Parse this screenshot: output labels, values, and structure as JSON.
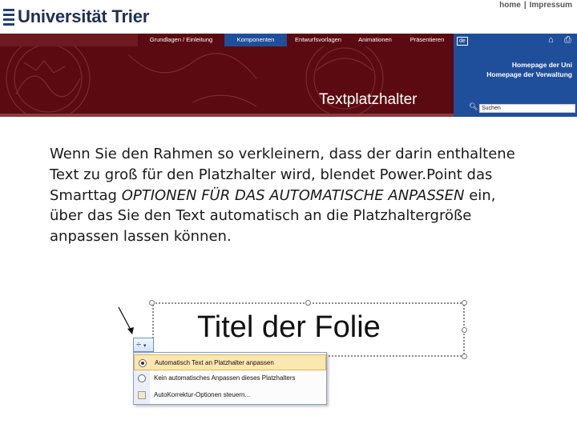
{
  "header": {
    "logo_text": "Universität Trier",
    "links": [
      "home",
      "Impressum"
    ]
  },
  "nav": {
    "items": [
      "Grundlagen / Einleitung",
      "Komponenten",
      "Entwurfsvorlagen",
      "Animationen",
      "Präsentieren"
    ],
    "active_index": 1
  },
  "banner": {
    "title": "Textplatzhalter"
  },
  "panel": {
    "lang": "de",
    "links": [
      "Homepage der Uni",
      "Homepage der Verwaltung"
    ],
    "search_value": "Suchen"
  },
  "content": {
    "text_before": "Wenn Sie den Rahmen so verkleinern, dass der darin enthaltene Text zu groß für den Platzhalter wird, blendet Power.Point das Smarttag ",
    "text_italic": "OPTIONEN FÜR DAS AUTOMATISCHE ANPASSEN",
    "text_after": " ein, über das Sie den Text automatisch an die Platzhaltergröße anpassen lassen können."
  },
  "screenshot": {
    "slide_title": "Titel der Folie",
    "smarttag_glyph": "÷",
    "menu_items": [
      "Automatisch Text an Platzhalter anpassen",
      "Kein automatisches Anpassen dieses Platzhalters",
      "AutoKorrektur-Optionen steuern..."
    ],
    "selected_index": 0
  },
  "colors": {
    "maroon": "#5a0a10",
    "blue": "#1f4f9a"
  }
}
